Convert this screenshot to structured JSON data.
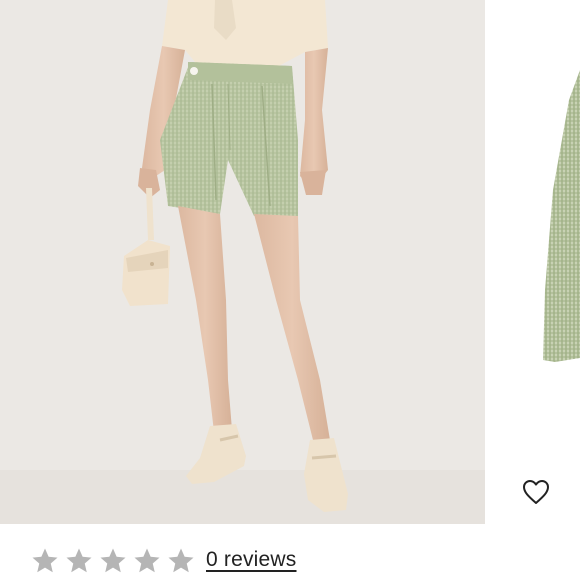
{
  "product_gallery": {
    "main_image_icon": "model-wearing-green-gingham-shorts-image",
    "next_image_icon": "gingham-shorts-product-detail-image"
  },
  "favorite": {
    "icon": "heart-outline-icon"
  },
  "reviews": {
    "rating": 0,
    "max_rating": 5,
    "star_color_empty": "#b5b5b5",
    "link_label": "0 reviews"
  },
  "colors": {
    "background": "#ebe8e4",
    "text": "#222222",
    "shorts": "#b9c6a4"
  }
}
